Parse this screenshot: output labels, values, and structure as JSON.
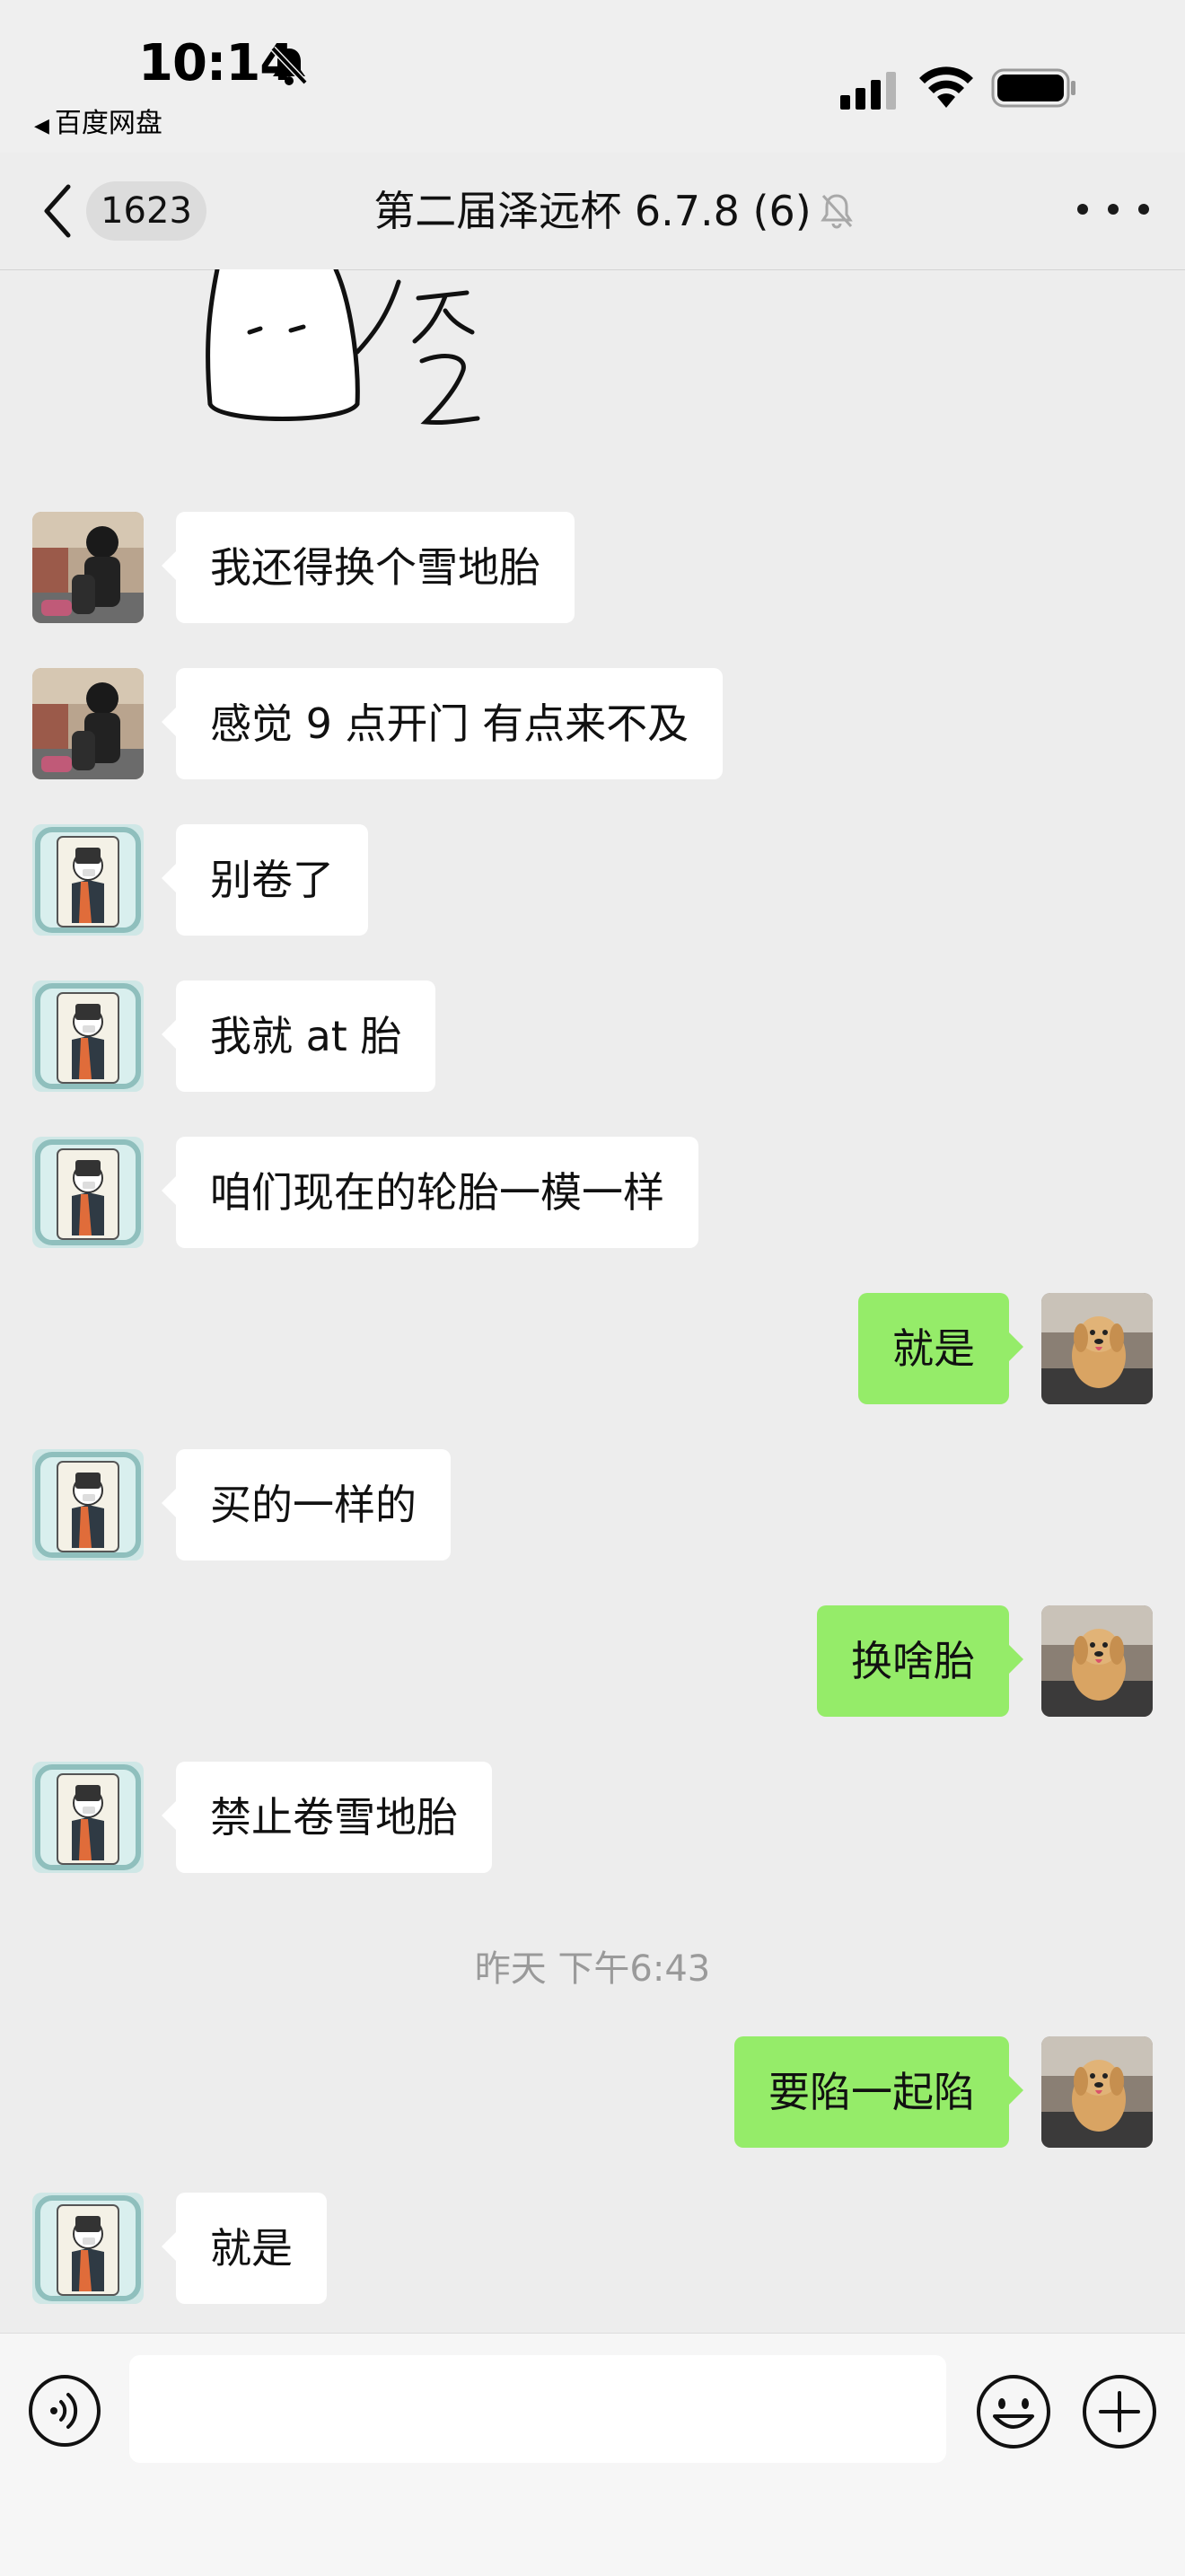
{
  "status_bar": {
    "time": "10:14",
    "back_app_label": "百度网盘"
  },
  "nav": {
    "unread_count": "1623",
    "title": "第二届泽远杯 6.7.8 (6)"
  },
  "messages": [
    {
      "side": "left",
      "sender": "avatar-rider",
      "text": "我还得换个雪地胎"
    },
    {
      "side": "left",
      "sender": "avatar-rider",
      "text": "感觉 9 点开门 有点来不及"
    },
    {
      "side": "left",
      "sender": "avatar-cartoon",
      "text": "别卷了"
    },
    {
      "side": "left",
      "sender": "avatar-cartoon",
      "text": "我就 at 胎"
    },
    {
      "side": "left",
      "sender": "avatar-cartoon",
      "text": "咱们现在的轮胎一模一样"
    },
    {
      "side": "right",
      "sender": "avatar-dog",
      "text": "就是"
    },
    {
      "side": "left",
      "sender": "avatar-cartoon",
      "text": "买的一样的"
    },
    {
      "side": "right",
      "sender": "avatar-dog",
      "text": "换啥胎"
    },
    {
      "side": "left",
      "sender": "avatar-cartoon",
      "text": "禁止卷雪地胎"
    },
    {
      "side": "right",
      "sender": "avatar-dog",
      "text": "要陷一起陷"
    },
    {
      "side": "left",
      "sender": "avatar-cartoon",
      "text": "就是"
    }
  ],
  "timestamp": "昨天 下午6:43",
  "input": {
    "value": "",
    "placeholder": ""
  },
  "colors": {
    "background": "#ededed",
    "bubble_self": "#95ec69",
    "bubble_other": "#ffffff"
  },
  "icons": [
    "bell-off-icon",
    "signal-icon",
    "wifi-icon",
    "battery-icon",
    "chevron-left-icon",
    "mute-bell-icon",
    "more-icon",
    "voice-icon",
    "emoji-icon",
    "plus-icon"
  ]
}
